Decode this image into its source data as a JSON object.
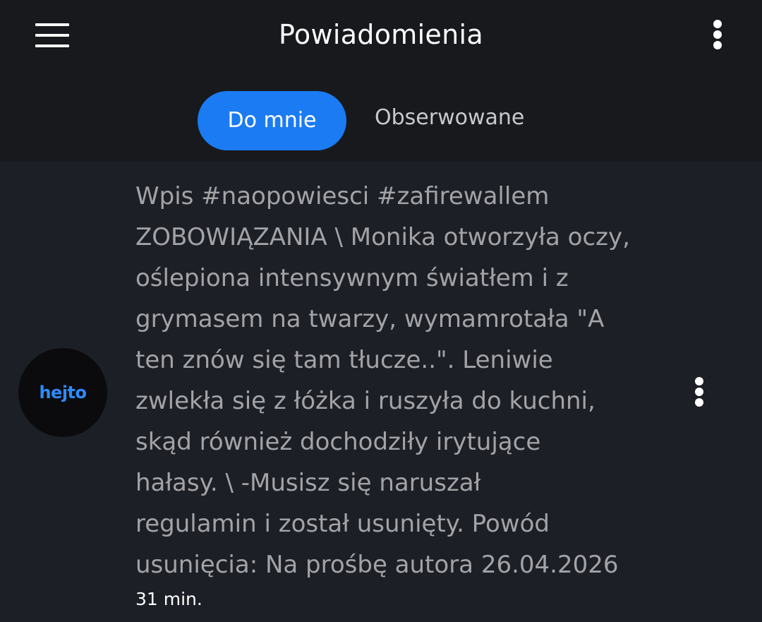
{
  "header": {
    "title": "Powiadomienia",
    "menu_icon": "hamburger-menu-icon",
    "more_icon": "more-vert-icon"
  },
  "tabs": [
    {
      "label": "Do mnie",
      "active": true
    },
    {
      "label": "Obserwowane",
      "active": false
    }
  ],
  "notification": {
    "avatar_text": "hejto",
    "text": "Wpis #naopowiesci #zafirewallem\nZOBOWIĄZANIA \\ Monika otworzyła oczy,\noślepiona intensywnym światłem i z\ngrymasem na twarzy, wymamrotała \"A\nten znów się tam tłucze..\". Leniwie\nzwlekła się z łóżka i ruszyła do kuchni,\nskąd również dochodziły irytujące\nhałasy. \\ -Musisz się naruszał\nregulamin i został usunięty. Powód\nusunięcia: Na prośbę autora 26.04.2026",
    "time": "31 min.",
    "more_icon": "more-vert-icon"
  },
  "colors": {
    "accent": "#1b7bf2",
    "background": "#1d1f26",
    "header_background": "#18191d"
  }
}
